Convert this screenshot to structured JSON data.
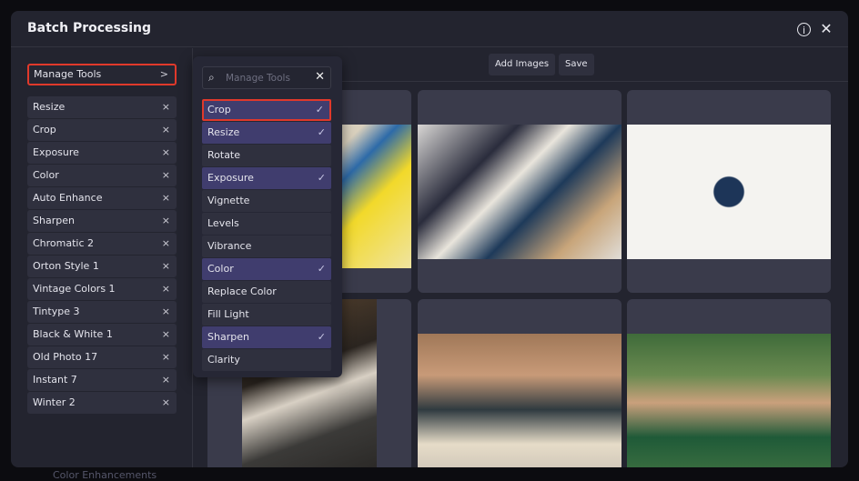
{
  "dialog": {
    "title": "Batch Processing",
    "info_icon": "info-icon",
    "close_icon": "close-icon"
  },
  "sidebar": {
    "manage_tools": "Manage Tools",
    "chevron": ">",
    "items": [
      "Resize",
      "Crop",
      "Exposure",
      "Color",
      "Auto Enhance",
      "Sharpen",
      "Chromatic 2",
      "Orton Style 1",
      "Vintage Colors 1",
      "Tintype 3",
      "Black & White 1",
      "Old Photo 17",
      "Instant 7",
      "Winter 2"
    ],
    "remove": "×"
  },
  "toolbar": {
    "add_images": "Add Images",
    "save": "Save"
  },
  "dropdown": {
    "search_placeholder": "Manage Tools",
    "items": [
      {
        "label": "Crop",
        "selected": true
      },
      {
        "label": "Resize",
        "selected": true
      },
      {
        "label": "Rotate",
        "selected": false
      },
      {
        "label": "Exposure",
        "selected": true
      },
      {
        "label": "Vignette",
        "selected": false
      },
      {
        "label": "Levels",
        "selected": false
      },
      {
        "label": "Vibrance",
        "selected": false
      },
      {
        "label": "Color",
        "selected": true
      },
      {
        "label": "Replace Color",
        "selected": false
      },
      {
        "label": "Fill Light",
        "selected": false
      },
      {
        "label": "Sharpen",
        "selected": true
      },
      {
        "label": "Clarity",
        "selected": false
      }
    ],
    "check": "✓"
  },
  "background": {
    "label": "Color Enhancements"
  },
  "colors": {
    "accent": "#403d6e",
    "highlight": "#e0392b"
  }
}
